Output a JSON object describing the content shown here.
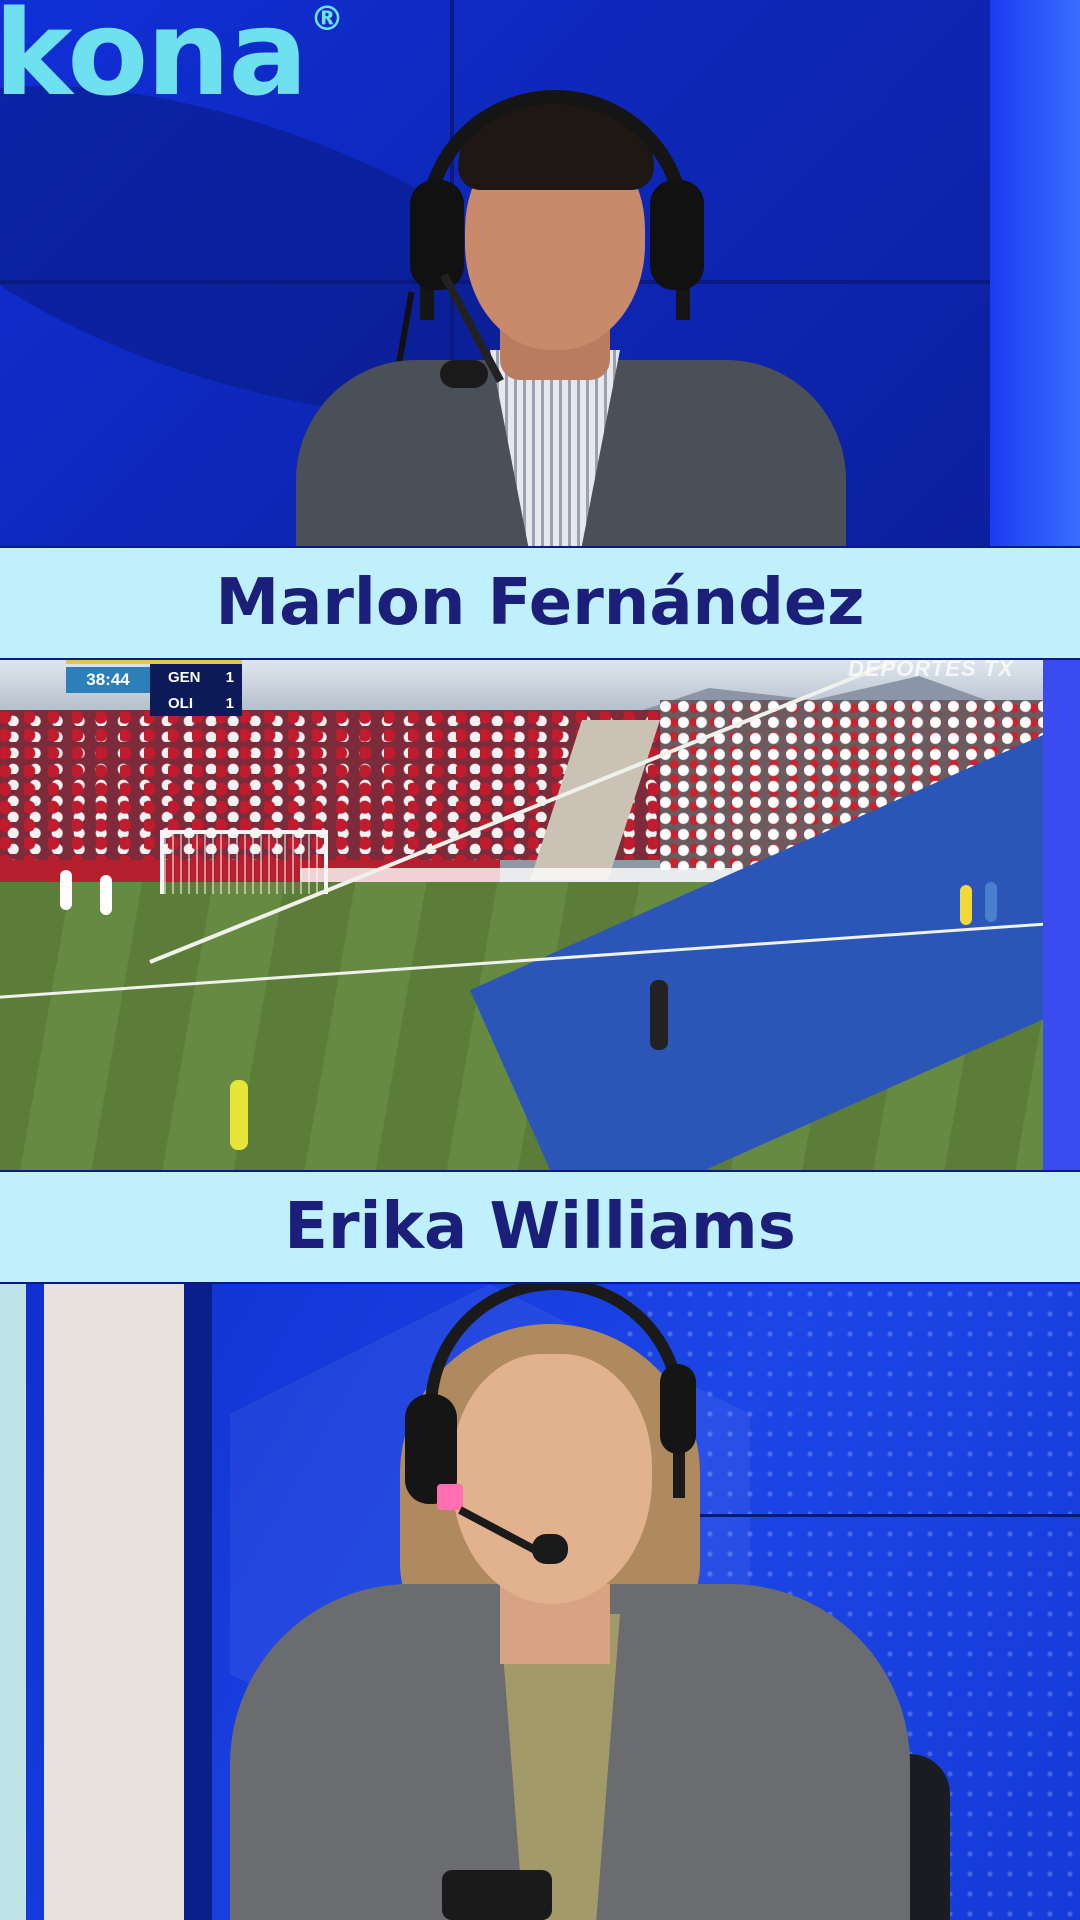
{
  "brand": {
    "logo_text": "kona",
    "registered": "®"
  },
  "commentators": {
    "top_name": "Marlon Fernández",
    "bottom_name": "Erika Williams"
  },
  "match": {
    "clock": "38:44",
    "home_team": "GEN",
    "home_score": "1",
    "away_team": "OLI",
    "away_score": "1",
    "broadcaster_watermark": "DEPORTES TX"
  },
  "colors": {
    "name_bar_bg": "#bff0fb",
    "name_text": "#1b1f7a",
    "studio_blue": "#1030d8",
    "logo_cyan": "#6fe0f0"
  }
}
